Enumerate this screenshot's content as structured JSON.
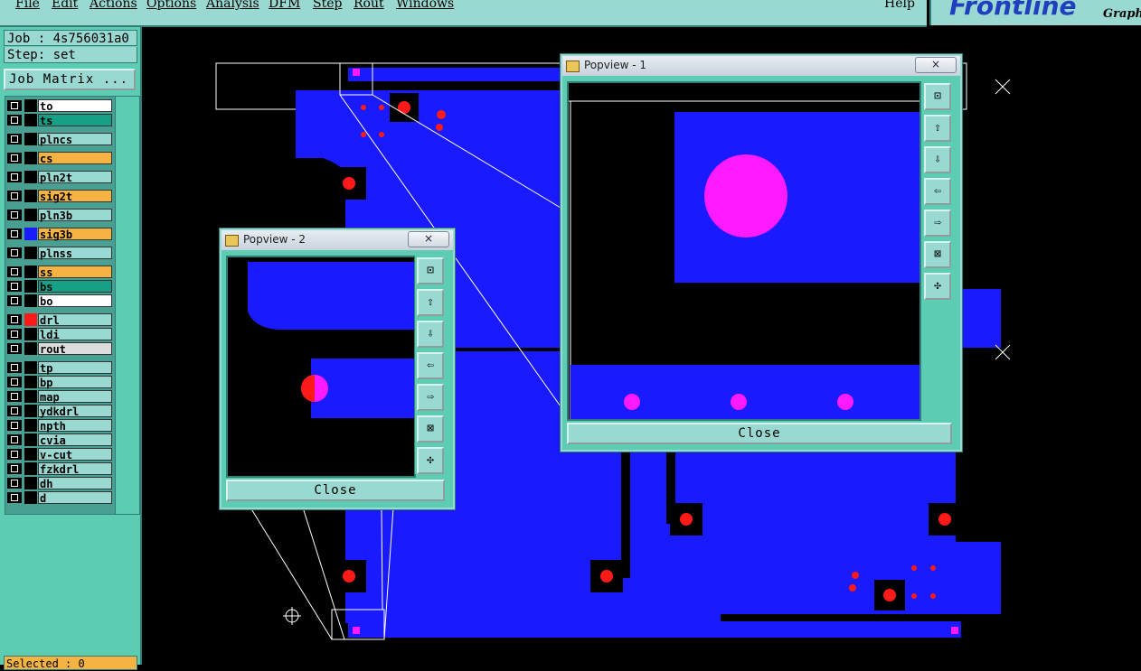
{
  "menu": {
    "items": [
      "File",
      "Edit",
      "Actions",
      "Options",
      "Analysis",
      "DFM",
      "Step",
      "Rout",
      "Windows"
    ],
    "help": "Help"
  },
  "logo": {
    "text": "Frontline",
    "sub": "Graphi"
  },
  "panel": {
    "job_label": "Job : 4s756031a0",
    "step_label": "Step: set",
    "job_matrix_button": "Job Matrix ...",
    "selected_label": "Selected : 0"
  },
  "layers": [
    {
      "name": "to",
      "color": "#ffffff"
    },
    {
      "name": "ts",
      "color": "#16a085"
    },
    {
      "name": "plncs",
      "color": "#9ad9d2"
    },
    {
      "name": "cs",
      "color": "#f5b342"
    },
    {
      "name": "pln2t",
      "color": "#9ad9d2"
    },
    {
      "name": "sig2t",
      "color": "#f5b342"
    },
    {
      "name": "pln3b",
      "color": "#9ad9d2"
    },
    {
      "name": "sig3b",
      "color": "#f5b342"
    },
    {
      "name": "plnss",
      "color": "#9ad9d2"
    },
    {
      "name": "ss",
      "color": "#f5b342"
    },
    {
      "name": "bs",
      "color": "#16a085"
    },
    {
      "name": "bo",
      "color": "#ffffff"
    },
    {
      "name": "drl",
      "color": "#9ad9d2"
    },
    {
      "name": "ldi",
      "color": "#9ad9d2"
    },
    {
      "name": "rout",
      "color": "#dcdcdc"
    },
    {
      "name": "tp",
      "color": "#9ad9d2"
    },
    {
      "name": "bp",
      "color": "#9ad9d2"
    },
    {
      "name": "map",
      "color": "#9ad9d2"
    },
    {
      "name": "ydkdrl",
      "color": "#9ad9d2"
    },
    {
      "name": "npth",
      "color": "#9ad9d2"
    },
    {
      "name": "cvia",
      "color": "#9ad9d2"
    },
    {
      "name": "v-cut",
      "color": "#9ad9d2"
    },
    {
      "name": "fzkdrl",
      "color": "#9ad9d2"
    },
    {
      "name": "dh",
      "color": "#9ad9d2"
    },
    {
      "name": "d",
      "color": "#9ad9d2"
    }
  ],
  "colors": {
    "board": "#1a1aff",
    "drill": "#ff1a1a",
    "pad": "#ff1aff",
    "panel_bg": "#5ccdb3",
    "panel_light": "#9ad9d2"
  },
  "popview1": {
    "title": "Popview - 1",
    "close": "Close",
    "x_label": "×"
  },
  "popview2": {
    "title": "Popview - 2",
    "close": "Close",
    "x_label": "×"
  },
  "tool_icons": [
    "zoom-fit-icon",
    "pan-up-icon",
    "pan-down-icon",
    "pan-left-icon",
    "pan-right-icon",
    "zoom-in-icon",
    "zoom-out-icon"
  ]
}
